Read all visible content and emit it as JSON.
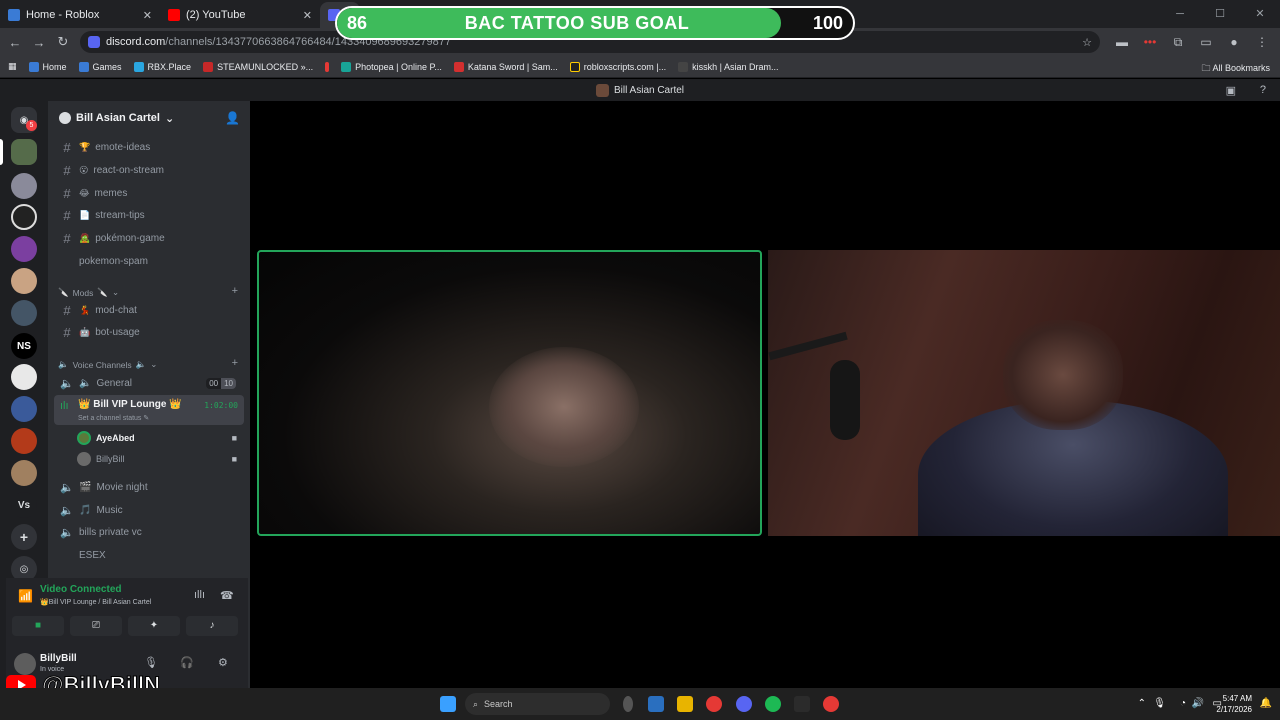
{
  "browser": {
    "tabs": [
      {
        "title": "Home - Roblox"
      },
      {
        "title": "(2) YouTube"
      }
    ],
    "url_host": "discord.com",
    "url_path": "/channels/1343770663864766484/1433409689693279877",
    "bookmarks": [
      "Home",
      "Games",
      "RBX.Place",
      "STEAMUNLOCKED »...",
      "Photopea | Online P...",
      "Katana Sword | Sam...",
      "robloxscripts.com |...",
      "kisskh | Asian Dram..."
    ],
    "all_bookmarks": "All Bookmarks"
  },
  "goal": {
    "current": "86",
    "title": "BAC TATTOO SUB GOAL",
    "target": "100",
    "progress": 0.86
  },
  "discord": {
    "window_title": "Bill Asian Cartel",
    "rail_badge": "5",
    "rail_letters": {
      "ns": "NS",
      "vs": "Vs"
    },
    "server_name": "Bill Asian Cartel",
    "channels": [
      {
        "emoji": "🏆",
        "name": "emote-ideas"
      },
      {
        "emoji": "😮",
        "name": "react-on-stream"
      },
      {
        "emoji": "😂",
        "name": "memes"
      },
      {
        "emoji": "📄",
        "name": "stream-tips"
      },
      {
        "emoji": "🧟",
        "name": "pokémon-game"
      },
      {
        "emoji": "",
        "name": "pokemon-spam"
      }
    ],
    "mods_category": "Mods",
    "mod_channels": [
      {
        "emoji": "💃",
        "name": "mod-chat"
      },
      {
        "emoji": "🤖",
        "name": "bot-usage"
      }
    ],
    "voice_category": "Voice Channels",
    "voice": {
      "general": {
        "name": "General",
        "count_a": "00",
        "count_b": "10"
      },
      "vip": {
        "name": "Bill VIP Lounge",
        "status": "Set a channel status",
        "timer": "1:02:00"
      },
      "users": [
        {
          "name": "AyeAbed"
        },
        {
          "name": "BillyBill"
        }
      ],
      "others": [
        "Movie night",
        "Music",
        "bills private vc",
        "ESEX"
      ]
    },
    "connection": {
      "status": "Video Connected",
      "where": "Bill VIP Lounge / Bill Asian Cartel"
    },
    "user": {
      "name": "BillyBill",
      "status": "In voice"
    }
  },
  "taskbar": {
    "search": "Search",
    "time": "5:47 AM",
    "date": "2/17/2026"
  },
  "watermark": "@BillyBillN",
  "colors": {
    "green": "#23a55a",
    "discord_blurple": "#5865f2",
    "goal_fill": "#3ebb5b"
  }
}
